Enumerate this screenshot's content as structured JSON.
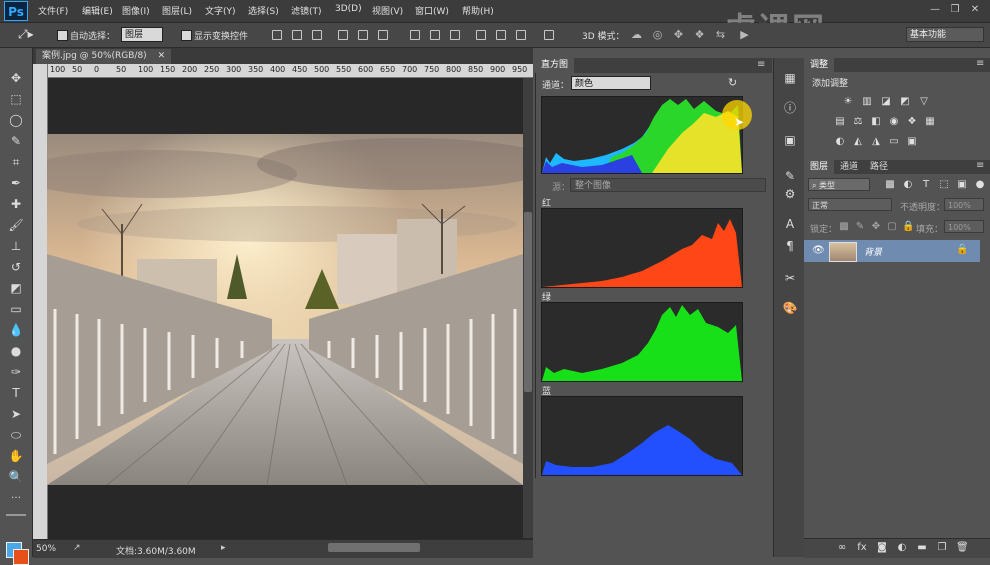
{
  "app": {
    "logo": "Ps"
  },
  "menu": [
    "文件(F)",
    "编辑(E)",
    "图像(I)",
    "图层(L)",
    "文字(Y)",
    "选择(S)",
    "滤镜(T)",
    "3D(D)",
    "视图(V)",
    "窗口(W)",
    "帮助(H)"
  ],
  "options": {
    "auto_select_label": "自动选择：",
    "auto_select_value": "图层",
    "show_transform_label": "显示变换控件",
    "mode3d_label": "3D 模式：",
    "workspace": "基本功能"
  },
  "document": {
    "tab_title": "案例.jpg @ 50%(RGB/8)",
    "zoom": "50%",
    "doc_size": "文档:3.60M/3.60M",
    "ruler_ticks": [
      "100",
      "50",
      "0",
      "50",
      "100",
      "150",
      "200",
      "250",
      "300",
      "350",
      "400",
      "450",
      "500",
      "550",
      "600",
      "650",
      "700",
      "750",
      "800",
      "850",
      "900",
      "950"
    ]
  },
  "histogram": {
    "tabs": [
      "直方图"
    ],
    "channel_label": "通道：",
    "channel_value": "颜色",
    "source_label": "源：",
    "source_value": "整个图像",
    "red_label": "红",
    "green_label": "绿",
    "blue_label": "蓝"
  },
  "adjustments": {
    "tab": "调整",
    "title": "添加调整"
  },
  "layers": {
    "tabs": [
      "图层",
      "通道",
      "路径"
    ],
    "filter_value": "类型",
    "blend_mode": "正常",
    "opacity_label": "不透明度：",
    "opacity_value": "100%",
    "lock_label": "锁定：",
    "fill_label": "填充：",
    "fill_value": "100%",
    "layer_name": "背景"
  },
  "colors": {
    "foreground": "#4aa8e8",
    "background": "#e8501a",
    "selected_layer": "#6f8bb0"
  },
  "watermark": "虎课网"
}
